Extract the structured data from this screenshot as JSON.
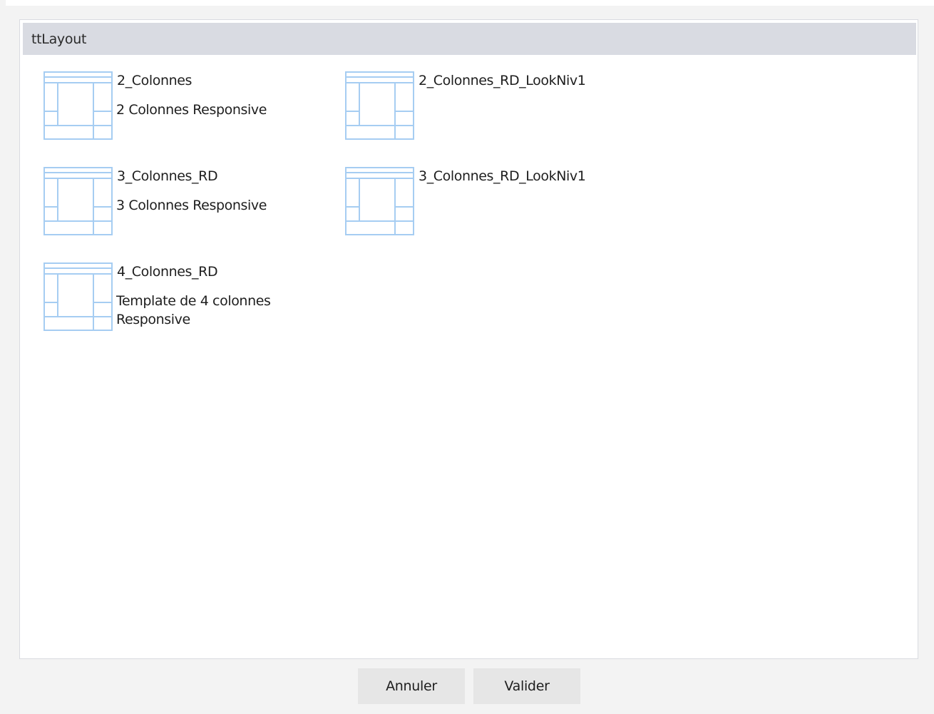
{
  "group": {
    "title": "ttLayout"
  },
  "layouts": [
    {
      "name": "2_Colonnes",
      "description": "2 Colonnes Responsive",
      "icon": "layout-template-icon"
    },
    {
      "name": "2_Colonnes_RD_LookNiv1",
      "description": "",
      "icon": "layout-template-icon"
    },
    {
      "name": "3_Colonnes_RD",
      "description": "3 Colonnes Responsive",
      "icon": "layout-template-icon"
    },
    {
      "name": "3_Colonnes_RD_LookNiv1",
      "description": "",
      "icon": "layout-template-icon"
    },
    {
      "name": "4_Colonnes_RD",
      "description": "Template de 4 colonnes Responsive",
      "icon": "layout-template-icon"
    }
  ],
  "buttons": {
    "cancel_label": "Annuler",
    "ok_label": "Valider"
  },
  "colors": {
    "header_bg": "#d9dbe2",
    "icon_stroke": "#a6cdf2",
    "button_bg": "#e6e6e6"
  }
}
